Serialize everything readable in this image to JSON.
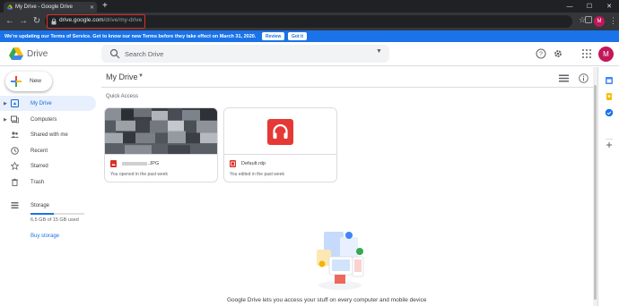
{
  "browser": {
    "tab_title": "My Drive - Google Drive",
    "url_host": "drive.google.com",
    "url_path": "/drive/my-drive",
    "profile_initial": "M"
  },
  "banner": {
    "text": "We're updating our Terms of Service. Get to know our new Terms before they take effect on March 31, 2020.",
    "review_label": "Review",
    "gotit_label": "Got it"
  },
  "header": {
    "brand": "Drive",
    "search_placeholder": "Search Drive",
    "avatar_initial": "M"
  },
  "sidebar": {
    "new_label": "New",
    "items": [
      {
        "label": "My Drive",
        "icon": "my-drive-icon",
        "active": true
      },
      {
        "label": "Computers",
        "icon": "computers-icon",
        "active": false
      },
      {
        "label": "Shared with me",
        "icon": "shared-icon",
        "active": false
      },
      {
        "label": "Recent",
        "icon": "recent-icon",
        "active": false
      },
      {
        "label": "Starred",
        "icon": "star-icon",
        "active": false
      },
      {
        "label": "Trash",
        "icon": "trash-icon",
        "active": false
      }
    ],
    "storage_label": "Storage",
    "storage_used": "6.5 GB of 15 GB used",
    "storage_fraction": 0.43,
    "buy_storage": "Buy storage"
  },
  "main": {
    "title": "My Drive",
    "quick_access_label": "Quick Access",
    "files": [
      {
        "name": ".JPG",
        "subtitle": "You opened in the past week",
        "type": "image"
      },
      {
        "name": "Default.rdp",
        "subtitle": "You edited in the past week",
        "type": "rdp"
      }
    ],
    "empty_text": "Google Drive lets you access your stuff on every computer and mobile device"
  },
  "colors": {
    "accent": "#1a73e8",
    "active_bg": "#e8f0fe",
    "rdp_red": "#e53935",
    "avatar": "#c2185b"
  }
}
